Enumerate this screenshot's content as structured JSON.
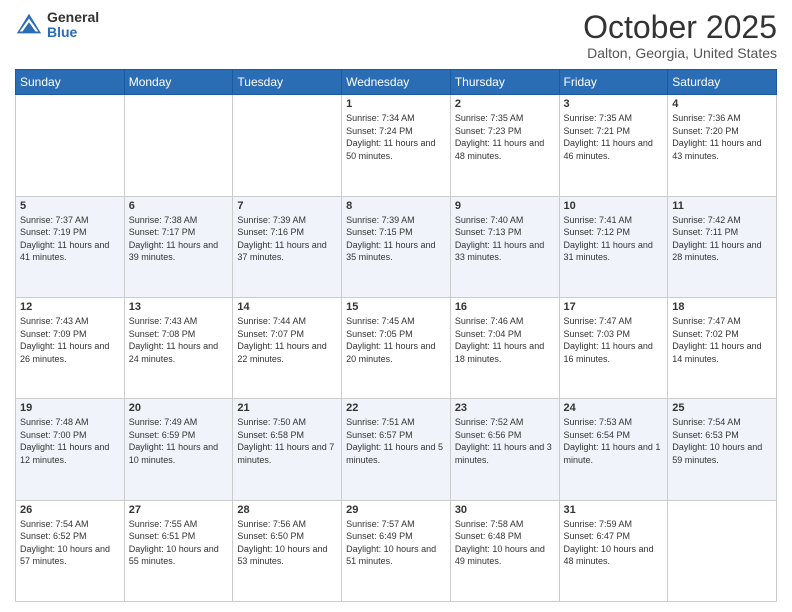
{
  "header": {
    "logo_general": "General",
    "logo_blue": "Blue",
    "month_title": "October 2025",
    "location": "Dalton, Georgia, United States"
  },
  "weekdays": [
    "Sunday",
    "Monday",
    "Tuesday",
    "Wednesday",
    "Thursday",
    "Friday",
    "Saturday"
  ],
  "weeks": [
    [
      {
        "day": "",
        "sunrise": "",
        "sunset": "",
        "daylight": ""
      },
      {
        "day": "",
        "sunrise": "",
        "sunset": "",
        "daylight": ""
      },
      {
        "day": "",
        "sunrise": "",
        "sunset": "",
        "daylight": ""
      },
      {
        "day": "1",
        "sunrise": "Sunrise: 7:34 AM",
        "sunset": "Sunset: 7:24 PM",
        "daylight": "Daylight: 11 hours and 50 minutes."
      },
      {
        "day": "2",
        "sunrise": "Sunrise: 7:35 AM",
        "sunset": "Sunset: 7:23 PM",
        "daylight": "Daylight: 11 hours and 48 minutes."
      },
      {
        "day": "3",
        "sunrise": "Sunrise: 7:35 AM",
        "sunset": "Sunset: 7:21 PM",
        "daylight": "Daylight: 11 hours and 46 minutes."
      },
      {
        "day": "4",
        "sunrise": "Sunrise: 7:36 AM",
        "sunset": "Sunset: 7:20 PM",
        "daylight": "Daylight: 11 hours and 43 minutes."
      }
    ],
    [
      {
        "day": "5",
        "sunrise": "Sunrise: 7:37 AM",
        "sunset": "Sunset: 7:19 PM",
        "daylight": "Daylight: 11 hours and 41 minutes."
      },
      {
        "day": "6",
        "sunrise": "Sunrise: 7:38 AM",
        "sunset": "Sunset: 7:17 PM",
        "daylight": "Daylight: 11 hours and 39 minutes."
      },
      {
        "day": "7",
        "sunrise": "Sunrise: 7:39 AM",
        "sunset": "Sunset: 7:16 PM",
        "daylight": "Daylight: 11 hours and 37 minutes."
      },
      {
        "day": "8",
        "sunrise": "Sunrise: 7:39 AM",
        "sunset": "Sunset: 7:15 PM",
        "daylight": "Daylight: 11 hours and 35 minutes."
      },
      {
        "day": "9",
        "sunrise": "Sunrise: 7:40 AM",
        "sunset": "Sunset: 7:13 PM",
        "daylight": "Daylight: 11 hours and 33 minutes."
      },
      {
        "day": "10",
        "sunrise": "Sunrise: 7:41 AM",
        "sunset": "Sunset: 7:12 PM",
        "daylight": "Daylight: 11 hours and 31 minutes."
      },
      {
        "day": "11",
        "sunrise": "Sunrise: 7:42 AM",
        "sunset": "Sunset: 7:11 PM",
        "daylight": "Daylight: 11 hours and 28 minutes."
      }
    ],
    [
      {
        "day": "12",
        "sunrise": "Sunrise: 7:43 AM",
        "sunset": "Sunset: 7:09 PM",
        "daylight": "Daylight: 11 hours and 26 minutes."
      },
      {
        "day": "13",
        "sunrise": "Sunrise: 7:43 AM",
        "sunset": "Sunset: 7:08 PM",
        "daylight": "Daylight: 11 hours and 24 minutes."
      },
      {
        "day": "14",
        "sunrise": "Sunrise: 7:44 AM",
        "sunset": "Sunset: 7:07 PM",
        "daylight": "Daylight: 11 hours and 22 minutes."
      },
      {
        "day": "15",
        "sunrise": "Sunrise: 7:45 AM",
        "sunset": "Sunset: 7:05 PM",
        "daylight": "Daylight: 11 hours and 20 minutes."
      },
      {
        "day": "16",
        "sunrise": "Sunrise: 7:46 AM",
        "sunset": "Sunset: 7:04 PM",
        "daylight": "Daylight: 11 hours and 18 minutes."
      },
      {
        "day": "17",
        "sunrise": "Sunrise: 7:47 AM",
        "sunset": "Sunset: 7:03 PM",
        "daylight": "Daylight: 11 hours and 16 minutes."
      },
      {
        "day": "18",
        "sunrise": "Sunrise: 7:47 AM",
        "sunset": "Sunset: 7:02 PM",
        "daylight": "Daylight: 11 hours and 14 minutes."
      }
    ],
    [
      {
        "day": "19",
        "sunrise": "Sunrise: 7:48 AM",
        "sunset": "Sunset: 7:00 PM",
        "daylight": "Daylight: 11 hours and 12 minutes."
      },
      {
        "day": "20",
        "sunrise": "Sunrise: 7:49 AM",
        "sunset": "Sunset: 6:59 PM",
        "daylight": "Daylight: 11 hours and 10 minutes."
      },
      {
        "day": "21",
        "sunrise": "Sunrise: 7:50 AM",
        "sunset": "Sunset: 6:58 PM",
        "daylight": "Daylight: 11 hours and 7 minutes."
      },
      {
        "day": "22",
        "sunrise": "Sunrise: 7:51 AM",
        "sunset": "Sunset: 6:57 PM",
        "daylight": "Daylight: 11 hours and 5 minutes."
      },
      {
        "day": "23",
        "sunrise": "Sunrise: 7:52 AM",
        "sunset": "Sunset: 6:56 PM",
        "daylight": "Daylight: 11 hours and 3 minutes."
      },
      {
        "day": "24",
        "sunrise": "Sunrise: 7:53 AM",
        "sunset": "Sunset: 6:54 PM",
        "daylight": "Daylight: 11 hours and 1 minute."
      },
      {
        "day": "25",
        "sunrise": "Sunrise: 7:54 AM",
        "sunset": "Sunset: 6:53 PM",
        "daylight": "Daylight: 10 hours and 59 minutes."
      }
    ],
    [
      {
        "day": "26",
        "sunrise": "Sunrise: 7:54 AM",
        "sunset": "Sunset: 6:52 PM",
        "daylight": "Daylight: 10 hours and 57 minutes."
      },
      {
        "day": "27",
        "sunrise": "Sunrise: 7:55 AM",
        "sunset": "Sunset: 6:51 PM",
        "daylight": "Daylight: 10 hours and 55 minutes."
      },
      {
        "day": "28",
        "sunrise": "Sunrise: 7:56 AM",
        "sunset": "Sunset: 6:50 PM",
        "daylight": "Daylight: 10 hours and 53 minutes."
      },
      {
        "day": "29",
        "sunrise": "Sunrise: 7:57 AM",
        "sunset": "Sunset: 6:49 PM",
        "daylight": "Daylight: 10 hours and 51 minutes."
      },
      {
        "day": "30",
        "sunrise": "Sunrise: 7:58 AM",
        "sunset": "Sunset: 6:48 PM",
        "daylight": "Daylight: 10 hours and 49 minutes."
      },
      {
        "day": "31",
        "sunrise": "Sunrise: 7:59 AM",
        "sunset": "Sunset: 6:47 PM",
        "daylight": "Daylight: 10 hours and 48 minutes."
      },
      {
        "day": "",
        "sunrise": "",
        "sunset": "",
        "daylight": ""
      }
    ]
  ]
}
